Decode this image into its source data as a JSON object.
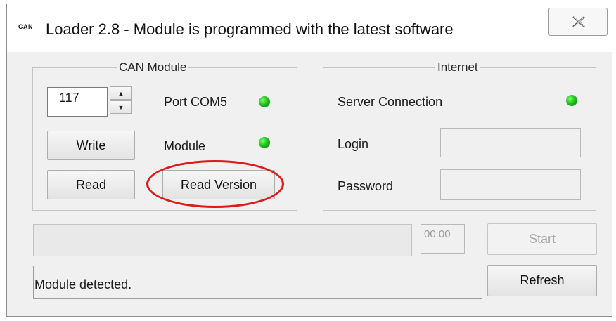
{
  "window": {
    "icon_text": "CAN",
    "title": "Loader 2.8 - Module is programmed with the latest software",
    "close_glyph": "✕"
  },
  "can_module": {
    "group_label": "CAN Module",
    "spin_value": "117",
    "spin_up": "▲",
    "spin_down": "▼",
    "write_label": "Write",
    "read_label": "Read",
    "read_version_label": "Read Version",
    "port_label": "Port COM5",
    "module_label": "Module",
    "port_status_color": "#1fc11f",
    "module_status_color": "#1fc11f"
  },
  "internet": {
    "group_label": "Internet",
    "server_label": "Server Connection",
    "server_status_color": "#1fc11f",
    "login_label": "Login",
    "login_value": "",
    "password_label": "Password",
    "password_value": ""
  },
  "bottom": {
    "time_value": "00:00",
    "start_label": "Start",
    "refresh_label": "Refresh",
    "status_text": "Module detected."
  },
  "colors": {
    "highlight": "#e01a1a",
    "led_green": "#1fc11f"
  }
}
